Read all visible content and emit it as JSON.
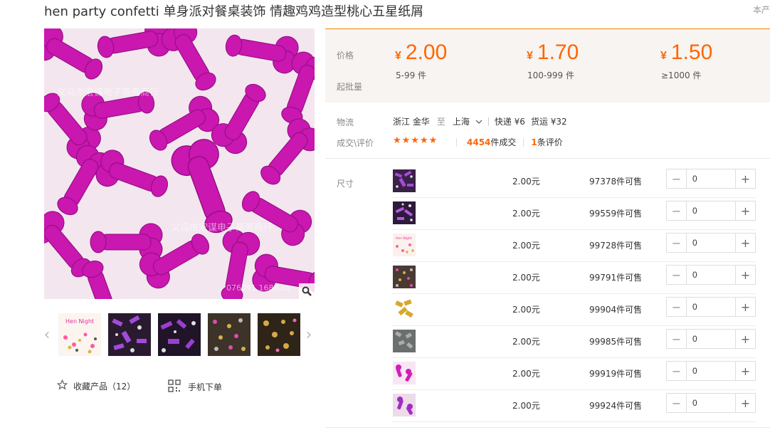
{
  "product": {
    "title": "hen party confetti 单身派对餐桌装饰 情趣鸡鸡造型桃心五星纸屑",
    "corner_link": "本产",
    "watermark_1": "义乌市宏谋电子商务商行",
    "watermark_2": "义乌市宏谋电子商务商行",
    "watermark_3": "076091.1688.co"
  },
  "gallery": {
    "thumbnails": [
      "hen-night-confetti",
      "purple-confetti-mix",
      "purple-confetti-mix-2",
      "multicolor-confetti",
      "gold-confetti-mix"
    ],
    "hen_night_text": "Hen Night",
    "favorite_label": "收藏产品（12）",
    "mobile_order_label": "手机下单"
  },
  "pricing": {
    "price_label": "价格",
    "batch_label": "起批量",
    "currency": "¥",
    "tiers": [
      {
        "price": "2.00",
        "qty": "5-99 件"
      },
      {
        "price": "1.70",
        "qty": "100-999 件"
      },
      {
        "price": "1.50",
        "qty": "≥1000 件"
      }
    ]
  },
  "logistics": {
    "label": "物流",
    "from": "浙江 金华",
    "to_word": "至",
    "to": "上海",
    "express": "快递 ¥6",
    "freight": "货运 ¥32"
  },
  "reviews": {
    "label": "成交\\评价",
    "stars": "★★★★★",
    "deal_count": "4454",
    "deal_suffix": "件成交",
    "review_count": "1",
    "review_suffix": "条评价"
  },
  "sku": {
    "label": "尺寸",
    "rows": [
      {
        "thumb": "purple-confetti",
        "price": "2.00元",
        "stock": "97378件可售",
        "qty": "0"
      },
      {
        "thumb": "purple-confetti-2",
        "price": "2.00元",
        "stock": "99559件可售",
        "qty": "0"
      },
      {
        "thumb": "hen-night",
        "price": "2.00元",
        "stock": "99728件可售",
        "qty": "0"
      },
      {
        "thumb": "multicolor",
        "price": "2.00元",
        "stock": "99791件可售",
        "qty": "0"
      },
      {
        "thumb": "gold",
        "price": "2.00元",
        "stock": "99904件可售",
        "qty": "0"
      },
      {
        "thumb": "silver-grey",
        "price": "2.00元",
        "stock": "99985件可售",
        "qty": "0"
      },
      {
        "thumb": "pink-magenta",
        "price": "2.00元",
        "stock": "99919件可售",
        "qty": "0"
      },
      {
        "thumb": "purple-magenta",
        "price": "2.00元",
        "stock": "99924件可售",
        "qty": "0"
      }
    ]
  },
  "colors": {
    "accent": "#ff6600",
    "magenta": "#d11fb6"
  }
}
